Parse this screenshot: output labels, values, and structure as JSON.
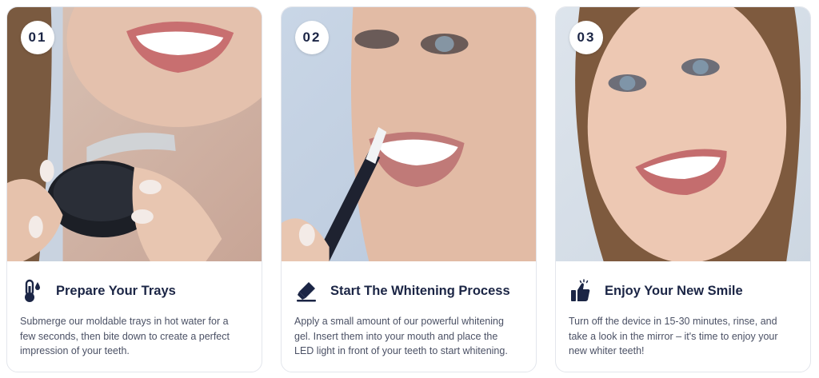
{
  "steps": [
    {
      "number": "01",
      "icon": "thermometer-drop-icon",
      "title": "Prepare Your Trays",
      "description": "Submerge our moldable trays in hot water for a few seconds, then bite down to create a perfect impression of your teeth."
    },
    {
      "number": "02",
      "icon": "whitening-pen-icon",
      "title": "Start The Whitening Process",
      "description": "Apply a small amount of our powerful whitening gel. Insert them into your mouth and place the LED light in front of your teeth to start whitening."
    },
    {
      "number": "03",
      "icon": "thumbs-up-icon",
      "title": "Enjoy Your New Smile",
      "description": "Turn off the device in 15-30 minutes, rinse, and take a look in the mirror – it's time to enjoy your new whiter teeth!"
    }
  ],
  "colors": {
    "heading": "#1b2545",
    "text": "#4b5165",
    "card_border": "#e3e6ec"
  }
}
